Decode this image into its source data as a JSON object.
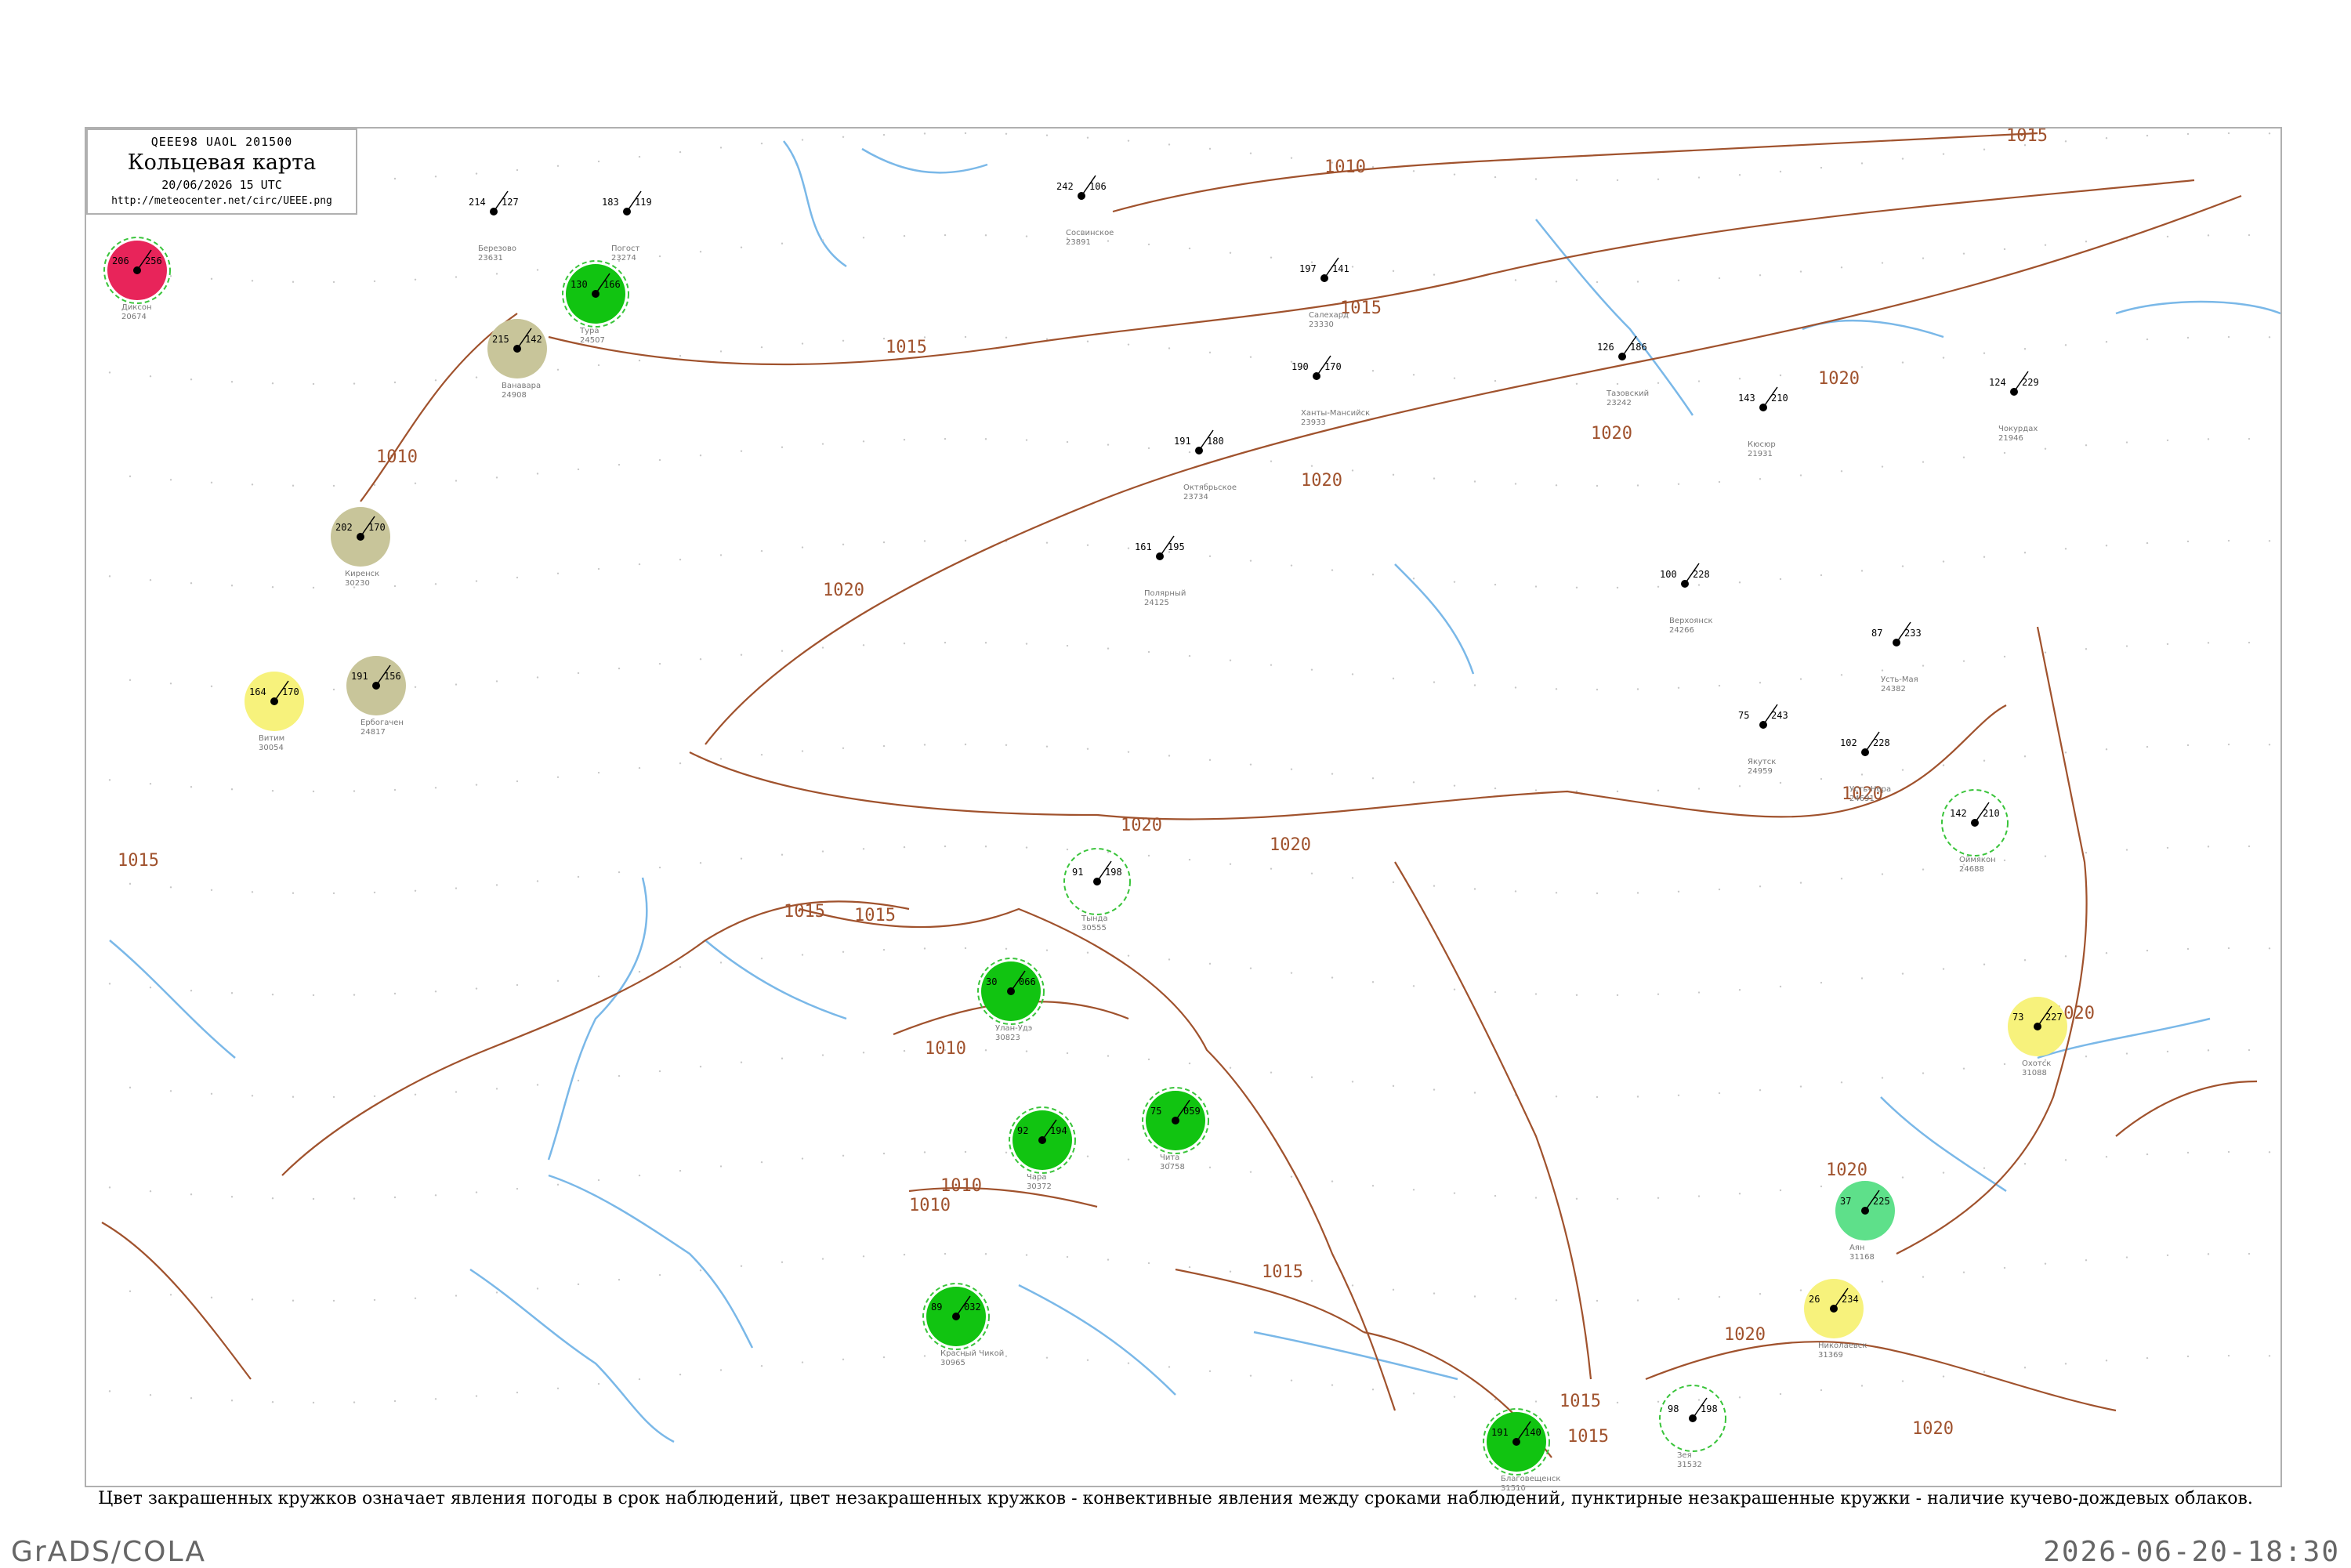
{
  "legend": {
    "code_line": "QEEE98  UAOL  201500",
    "title": "Кольцевая карта",
    "date": "20/06/2026 15 UTC",
    "url": "http://meteocenter.net/circ/UEEE.png"
  },
  "footnote": "Цвет закрашенных кружков означает явления погоды в срок наблюдений, цвет незакрашенных кружков - конвективные явления между сроками наблюдений, пунктирные незакрашенные кружки - наличие кучево-дождевых облаков.",
  "footer": {
    "left": "GrADS/COLA",
    "right": "2026-06-20-18:30"
  },
  "colors": {
    "isobar": "#a0522d",
    "river": "#7ab8e8",
    "thunder_fill": "#11c411",
    "thunder_ring": "#2db52d",
    "drizzle_fill": "#c8c59a",
    "severe_fill": "#e8245a",
    "haze_fill": "#f7f27c",
    "showers_fill": "#5ee08a",
    "dashed_cb": "#39c43a"
  },
  "isobar_labels": [
    "1010",
    "1015",
    "1015",
    "1015",
    "1020",
    "1020",
    "1020",
    "1020",
    "1020",
    "1015",
    "1010",
    "1010",
    "1015",
    "1020",
    "1010",
    "1015",
    "1020",
    "1020",
    "1020",
    "1015",
    "1015",
    "1020",
    "1020",
    "1010",
    "1015"
  ],
  "stations": [
    {
      "id": "st-1",
      "code": "183",
      "pressure": "119",
      "name": "Погост",
      "index": "23274",
      "state": "plain"
    },
    {
      "id": "st-2",
      "code": "242",
      "pressure": "106",
      "name": "Сосвинское",
      "index": "23891",
      "state": "plain"
    },
    {
      "id": "st-3",
      "code": "197",
      "pressure": "141",
      "name": "Салехард",
      "index": "23330",
      "state": "plain"
    },
    {
      "id": "st-4",
      "code": "214",
      "pressure": "127",
      "name": "Березово",
      "index": "23631",
      "state": "plain"
    },
    {
      "id": "st-5",
      "code": "190",
      "pressure": "170",
      "name": "Ханты-Мансийск",
      "index": "23933",
      "state": "plain"
    },
    {
      "id": "st-6",
      "code": "191",
      "pressure": "180",
      "name": "Октябрьское",
      "index": "23734",
      "state": "plain"
    },
    {
      "id": "st-7",
      "code": "161",
      "pressure": "195",
      "name": "Полярный",
      "index": "24125",
      "state": "plain"
    },
    {
      "id": "st-8",
      "code": "126",
      "pressure": "186",
      "name": "Тазовский",
      "index": "23242",
      "state": "plain"
    },
    {
      "id": "st-9",
      "code": "124",
      "pressure": "229",
      "name": "Чокурдах",
      "index": "21946",
      "state": "plain"
    },
    {
      "id": "st-10",
      "code": "143",
      "pressure": "210",
      "name": "Кюсюр",
      "index": "21931",
      "state": "plain"
    },
    {
      "id": "st-11",
      "code": "100",
      "pressure": "228",
      "name": "Верхоянск",
      "index": "24266",
      "state": "plain"
    },
    {
      "id": "st-12",
      "code": "87",
      "pressure": "233",
      "name": "Усть-Мая",
      "index": "24382",
      "state": "plain"
    },
    {
      "id": "st-13",
      "code": "75",
      "pressure": "243",
      "name": "Якутск",
      "index": "24959",
      "state": "plain"
    },
    {
      "id": "st-14",
      "code": "102",
      "pressure": "228",
      "name": "Усть-Нера",
      "index": "24691",
      "state": "plain"
    },
    {
      "id": "st-15",
      "code": "142",
      "pressure": "210",
      "name": "Оймякон",
      "index": "24688",
      "state": "dashed"
    },
    {
      "id": "st-16",
      "code": "73",
      "pressure": "227",
      "name": "Охотск",
      "index": "31088",
      "state": "haze"
    },
    {
      "id": "st-17",
      "code": "37",
      "pressure": "225",
      "name": "Аян",
      "index": "31168",
      "state": "showers"
    },
    {
      "id": "st-18",
      "code": "26",
      "pressure": "234",
      "name": "Николаевск",
      "index": "31369",
      "state": "haze"
    },
    {
      "id": "st-19",
      "code": "130",
      "pressure": "166",
      "name": "Тура",
      "index": "24507",
      "state": "thunder"
    },
    {
      "id": "st-20",
      "code": "215",
      "pressure": "142",
      "name": "Ванавара",
      "index": "24908",
      "state": "drizzle"
    },
    {
      "id": "st-21",
      "code": "202",
      "pressure": "170",
      "name": "Киренск",
      "index": "30230",
      "state": "drizzle"
    },
    {
      "id": "st-22",
      "code": "191",
      "pressure": "156",
      "name": "Ербогачен",
      "index": "24817",
      "state": "drizzle"
    },
    {
      "id": "st-23",
      "code": "164",
      "pressure": "170",
      "name": "Витим",
      "index": "30054",
      "state": "haze"
    },
    {
      "id": "st-24",
      "code": "92",
      "pressure": "194",
      "name": "Чара",
      "index": "30372",
      "state": "thunder"
    },
    {
      "id": "st-25",
      "code": "91",
      "pressure": "198",
      "name": "Тында",
      "index": "30555",
      "state": "dashed"
    },
    {
      "id": "st-26",
      "code": "98",
      "pressure": "198",
      "name": "Зея",
      "index": "31532",
      "state": "dashed"
    },
    {
      "id": "st-27",
      "code": "191",
      "pressure": "140",
      "name": "Благовещенск",
      "index": "31510",
      "state": "thunder"
    },
    {
      "id": "st-28",
      "code": "30",
      "pressure": "066",
      "name": "Улан-Удэ",
      "index": "30823",
      "state": "thunder"
    },
    {
      "id": "st-29",
      "code": "75",
      "pressure": "059",
      "name": "Чита",
      "index": "30758",
      "state": "thunder"
    },
    {
      "id": "st-30",
      "code": "89",
      "pressure": "032",
      "name": "Красный Чикой",
      "index": "30965",
      "state": "thunder"
    },
    {
      "id": "st-31",
      "code": "206",
      "pressure": "256",
      "name": "Диксон",
      "index": "20674",
      "state": "severe"
    }
  ]
}
